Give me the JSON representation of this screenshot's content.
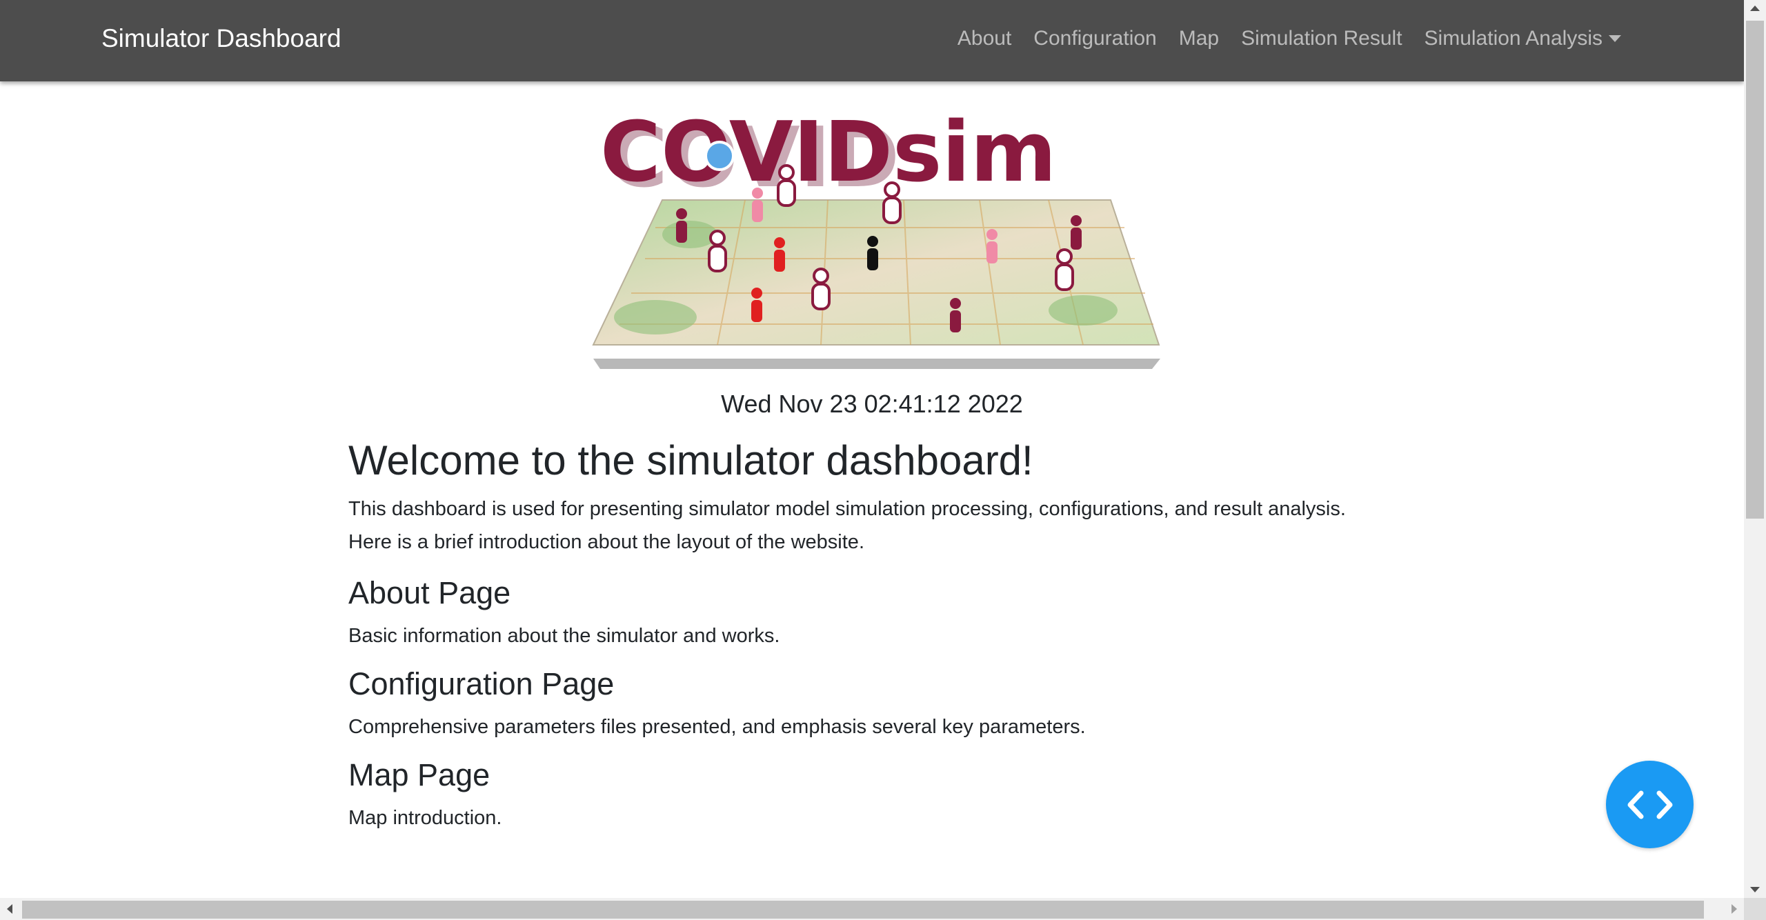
{
  "navbar": {
    "brand": "Simulator Dashboard",
    "links": [
      {
        "label": "About"
      },
      {
        "label": "Configuration"
      },
      {
        "label": "Map"
      },
      {
        "label": "Simulation Result"
      },
      {
        "label": "Simulation Analysis"
      }
    ],
    "background_color": "#4d4d4d"
  },
  "logo": {
    "text": "COVIDsim",
    "text_color": "#8a1a3f"
  },
  "main": {
    "date": "Wed Nov 23 02:41:12 2022",
    "title": "Welcome to the simulator dashboard!",
    "intro_line1": "This dashboard is used for presenting simulator model simulation processing, configurations, and result analysis.",
    "intro_line2": "Here is a brief introduction about the layout of the website.",
    "sections": [
      {
        "heading": "About Page",
        "text": "Basic information about the simulator and works."
      },
      {
        "heading": "Configuration Page",
        "text": "Comprehensive parameters files presented, and emphasis several key parameters."
      },
      {
        "heading": "Map Page",
        "text": "Map introduction."
      }
    ]
  },
  "fab": {
    "icon": "code-brackets-icon",
    "color": "#1a9af3"
  }
}
